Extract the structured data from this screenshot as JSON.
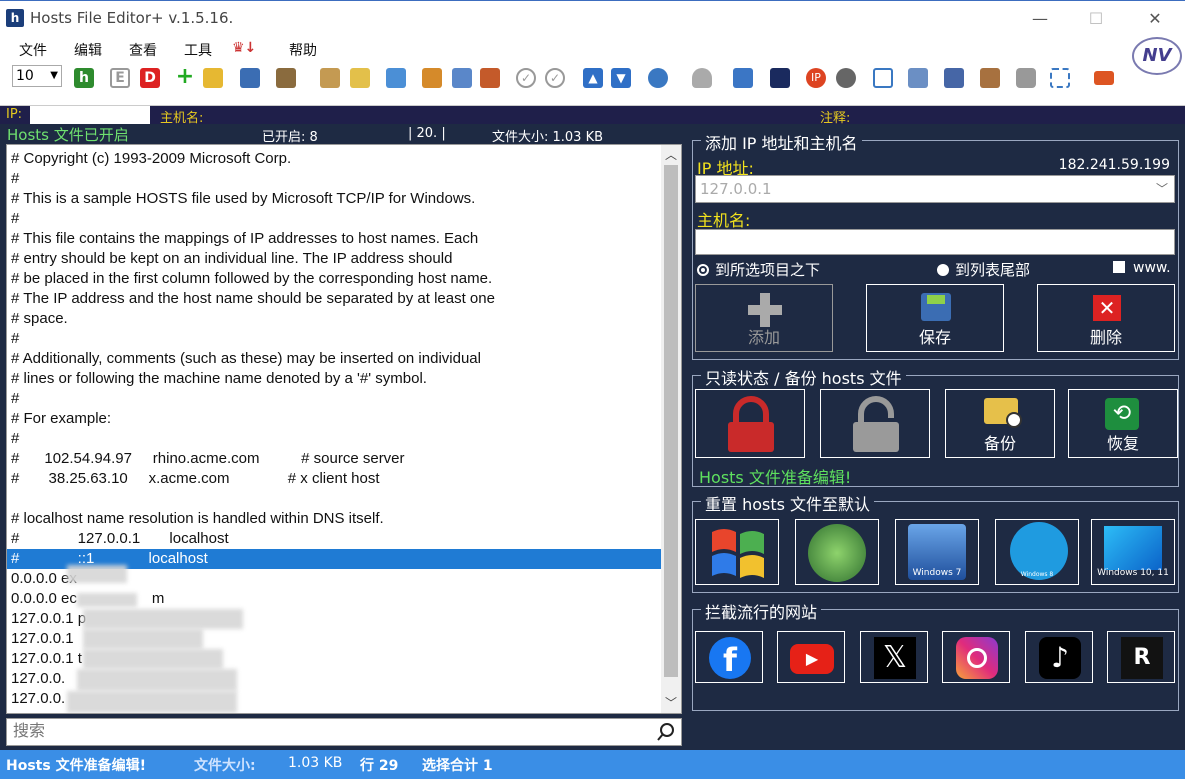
{
  "window": {
    "title": "Hosts File Editor+ v.1.5.16."
  },
  "menu": [
    "文件",
    "编辑",
    "查看",
    "工具",
    "帮助"
  ],
  "toolbar": {
    "zoom": "10"
  },
  "header": {
    "ip_label": "IP:",
    "hostname_label": "主机名:",
    "comment_label": "注释:"
  },
  "status": {
    "state": "Hosts 文件已开启",
    "enabled": "已开启: 8",
    "count": "| 20. |",
    "filesize": "文件大小: 1.03 KB"
  },
  "editor": {
    "lines": [
      "# Copyright (c) 1993-2009 Microsoft Corp.",
      "#",
      "# This is a sample HOSTS file used by Microsoft TCP/IP for Windows.",
      "#",
      "# This file contains the mappings of IP addresses to host names. Each",
      "# entry should be kept on an individual line. The IP address should",
      "# be placed in the first column followed by the corresponding host name.",
      "# The IP address and the host name should be separated by at least one",
      "# space.",
      "#",
      "# Additionally, comments (such as these) may be inserted on individual",
      "# lines or following the machine name denoted by a '#' symbol.",
      "#",
      "# For example:",
      "#",
      "#      102.54.94.97     rhino.acme.com          # source server",
      "#       38.25.63.10     x.acme.com              # x client host",
      "",
      "# localhost name resolution is handled within DNS itself.",
      "#              127.0.0.1       localhost",
      "#              ::1             localhost",
      "0.0.0.0 ex",
      "0.0.0.0 ec                  m",
      "127.0.0.1 p",
      "127.0.0.1",
      "127.0.0.1 t",
      "127.0.0.",
      "127.0.0."
    ]
  },
  "search": {
    "placeholder": "搜索"
  },
  "bottom": {
    "state": "Hosts 文件准备编辑!",
    "filesize_label": "文件大小:",
    "filesize": "1.03 KB",
    "line": "行 29",
    "selection": "选择合计 1"
  },
  "add_panel": {
    "legend": "添加 IP 地址和主机名",
    "ip_label": "IP 地址:",
    "external_ip": "182.241.59.199",
    "ip_value": "127.0.0.1",
    "host_label": "主机名:",
    "host_value": "",
    "radio1": "到所选项目之下",
    "radio2": "到列表尾部",
    "www": "www.",
    "add": "添加",
    "save": "保存",
    "delete": "删除"
  },
  "backup_panel": {
    "legend": "只读状态 / 备份 hosts 文件",
    "backup": "备份",
    "restore": "恢复",
    "status": "Hosts 文件准备编辑!"
  },
  "reset_panel": {
    "legend": "重置 hosts 文件至默认",
    "win7": "Windows 7",
    "win8": "Windows 8",
    "win1011": "Windows 10, 11"
  },
  "block_panel": {
    "legend": "拦截流行的网站"
  }
}
